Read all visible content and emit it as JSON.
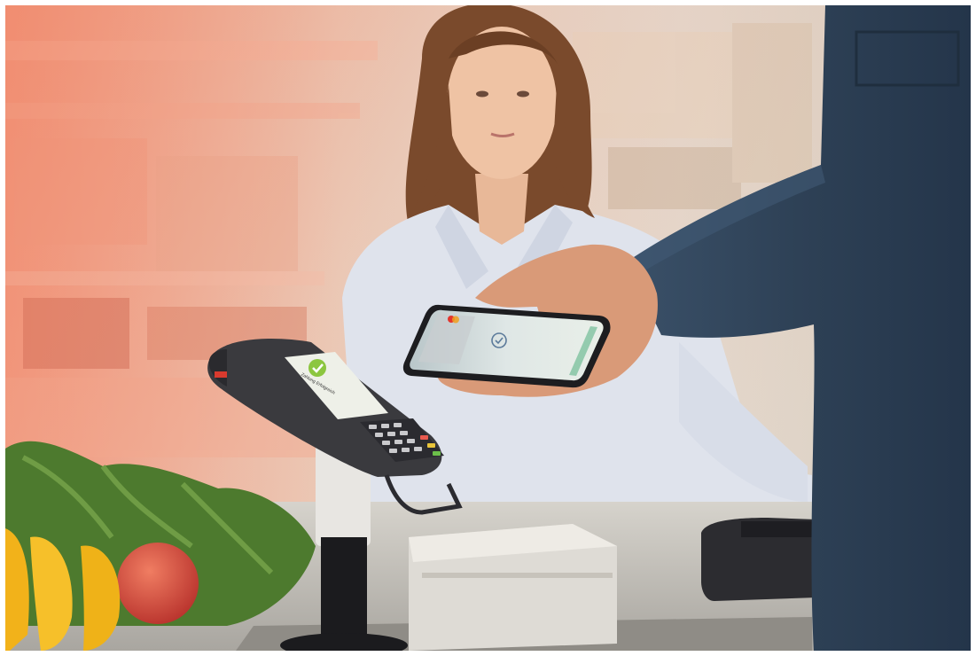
{
  "photo": {
    "subject": "Contactless mobile payment at a supermarket checkout",
    "terminal_screen_text": "Zahlung Erfolgreich",
    "colors": {
      "warm_overlay": "#f07a5a",
      "shirt": "#dfe3ec",
      "denim": "#2e4156",
      "terminal": "#3a3a3e",
      "counter": "#c9c7c2",
      "printer": "#dedbd5",
      "greens": "#4d7a2e",
      "banana": "#f2b21a",
      "apple": "#d9473d",
      "success": "#8cc63f"
    }
  },
  "icons": {
    "terminal_check": "check-icon",
    "phone_check": "check-circle-icon",
    "card_brand": "mastercard-icon"
  }
}
